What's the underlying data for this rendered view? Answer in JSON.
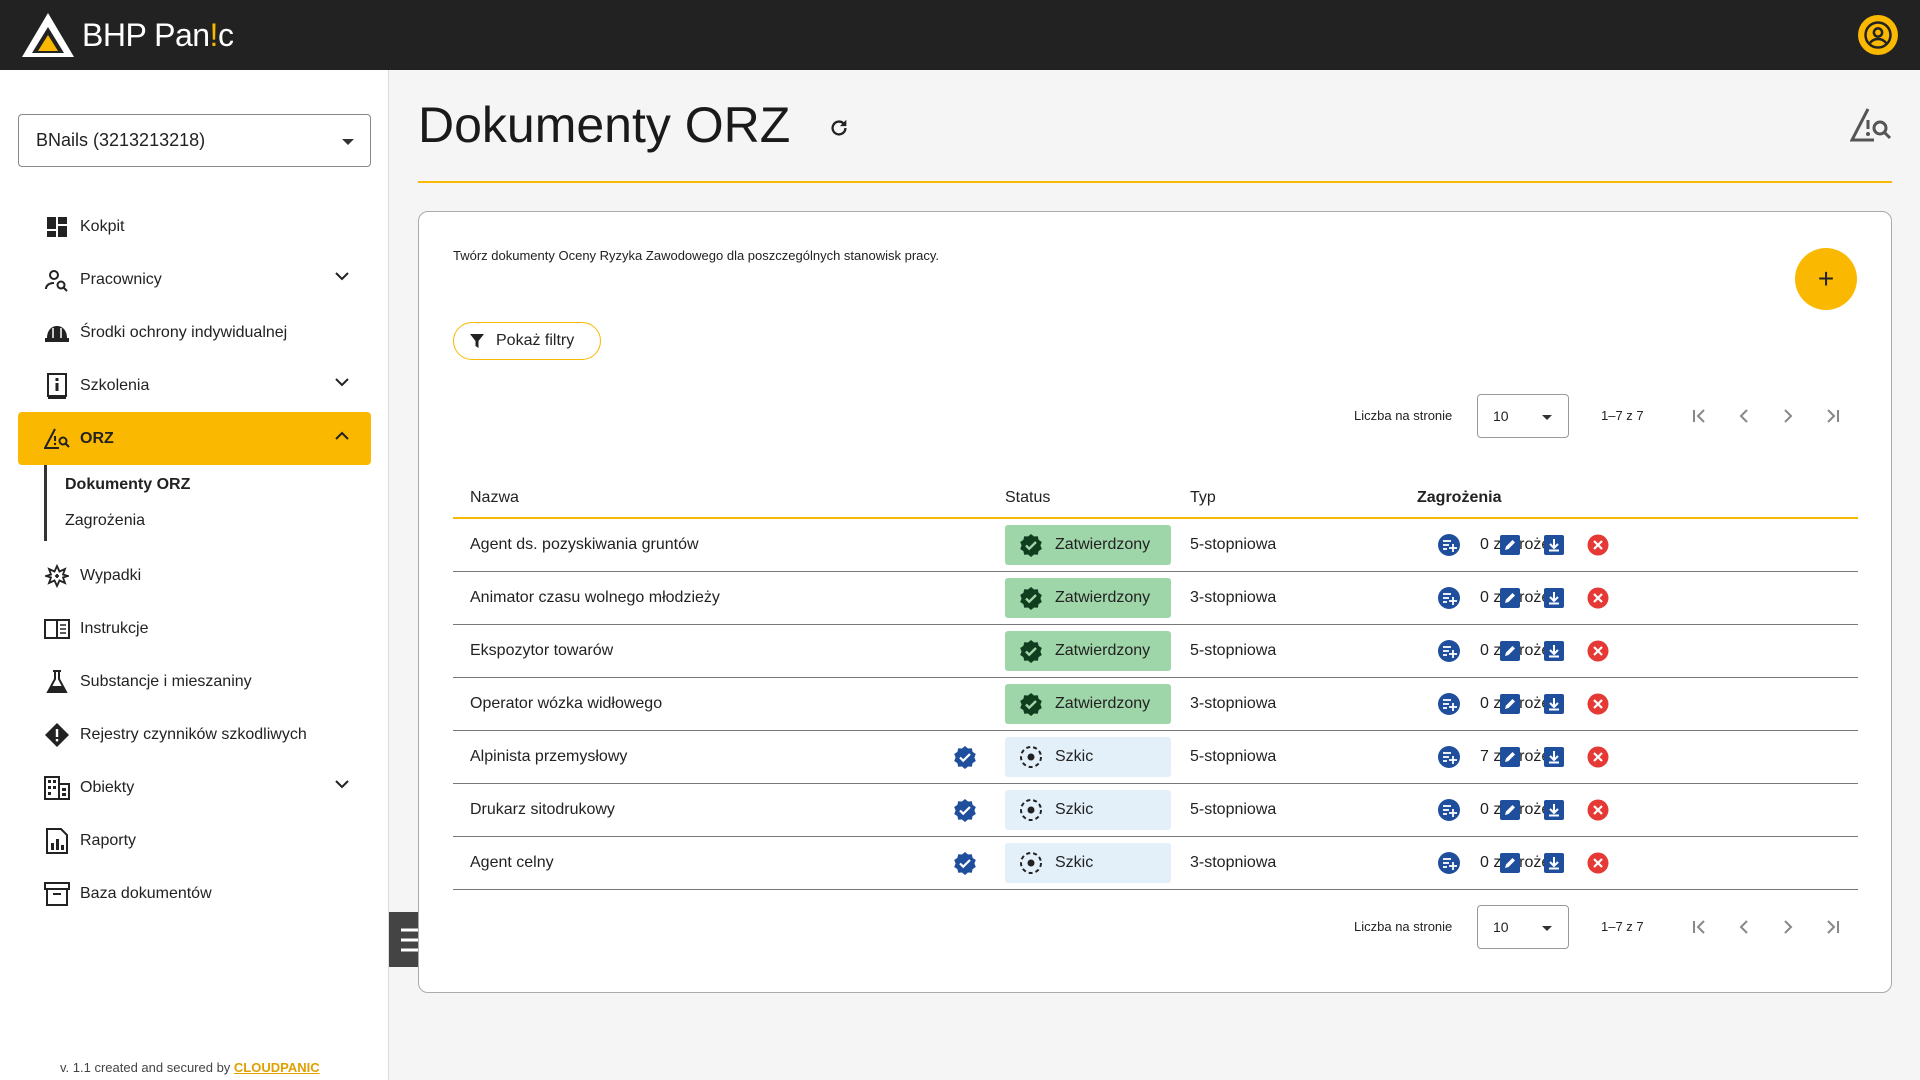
{
  "app": {
    "brand_main": "BHP Pan",
    "brand_accent": "!",
    "brand_end": "c"
  },
  "colors": {
    "accent": "#fbb800",
    "topbar": "#222222",
    "approved": "#9fd6a9",
    "draft": "#e3f0fa",
    "danger": "#e53935",
    "primary_icon": "#1f4e9c"
  },
  "sidebar": {
    "company": "BNails (3213213218)",
    "items": [
      {
        "label": "Kokpit",
        "icon": "dashboard-icon"
      },
      {
        "label": "Pracownicy",
        "icon": "person-search-icon"
      },
      {
        "label": "Środki ochrony indywidualnej",
        "icon": "helmet-icon"
      },
      {
        "label": "Szkolenia",
        "icon": "book-info-icon"
      },
      {
        "label": "ORZ",
        "icon": "warning-search-icon"
      },
      {
        "label": "Wypadki",
        "icon": "medical-icon"
      },
      {
        "label": "Instrukcje",
        "icon": "open-book-icon"
      },
      {
        "label": "Substancje i mieszaniny",
        "icon": "flask-icon"
      },
      {
        "label": "Rejestry czynników szkodliwych",
        "icon": "alert-diamond-icon"
      },
      {
        "label": "Obiekty",
        "icon": "building-icon"
      },
      {
        "label": "Raporty",
        "icon": "report-icon"
      },
      {
        "label": "Baza dokumentów",
        "icon": "archive-icon"
      }
    ],
    "sub_orz": [
      {
        "label": "Dokumenty ORZ"
      },
      {
        "label": "Zagrożenia"
      }
    ],
    "footer_text": "v. 1.1 created and secured by ",
    "footer_link": "CLOUDPANIC"
  },
  "main": {
    "title": "Dokumenty ORZ",
    "description": "Twórz dokumenty Oceny Ryzyka Zawodowego dla poszczególnych stanowisk pracy.",
    "filter_label": "Pokaż filtry",
    "add_label": "+",
    "pager": {
      "label": "Liczba na stronie",
      "per_page": "10",
      "range": "1–7 z 7"
    },
    "columns": {
      "name": "Nazwa",
      "status": "Status",
      "type": "Typ",
      "hazards": "Zagrożenia"
    },
    "rows": [
      {
        "name": "Agent ds. pozyskiwania gruntów",
        "verified": false,
        "status": "Zatwierdzony",
        "status_kind": "approved",
        "type": "5-stopniowa",
        "hazards": "0 zagrożeń"
      },
      {
        "name": "Animator czasu wolnego młodzieży",
        "verified": false,
        "status": "Zatwierdzony",
        "status_kind": "approved",
        "type": "3-stopniowa",
        "hazards": "0 zagrożeń"
      },
      {
        "name": "Ekspozytor towarów",
        "verified": false,
        "status": "Zatwierdzony",
        "status_kind": "approved",
        "type": "5-stopniowa",
        "hazards": "0 zagrożeń"
      },
      {
        "name": "Operator wózka widłowego",
        "verified": false,
        "status": "Zatwierdzony",
        "status_kind": "approved",
        "type": "3-stopniowa",
        "hazards": "0 zagrożeń"
      },
      {
        "name": "Alpinista przemysłowy",
        "verified": true,
        "status": "Szkic",
        "status_kind": "draft",
        "type": "5-stopniowa",
        "hazards": "7 zagrożeń"
      },
      {
        "name": "Drukarz sitodrukowy",
        "verified": true,
        "status": "Szkic",
        "status_kind": "draft",
        "type": "5-stopniowa",
        "hazards": "0 zagrożeń"
      },
      {
        "name": "Agent celny",
        "verified": true,
        "status": "Szkic",
        "status_kind": "draft",
        "type": "3-stopniowa",
        "hazards": "0 zagrożeń"
      }
    ]
  }
}
